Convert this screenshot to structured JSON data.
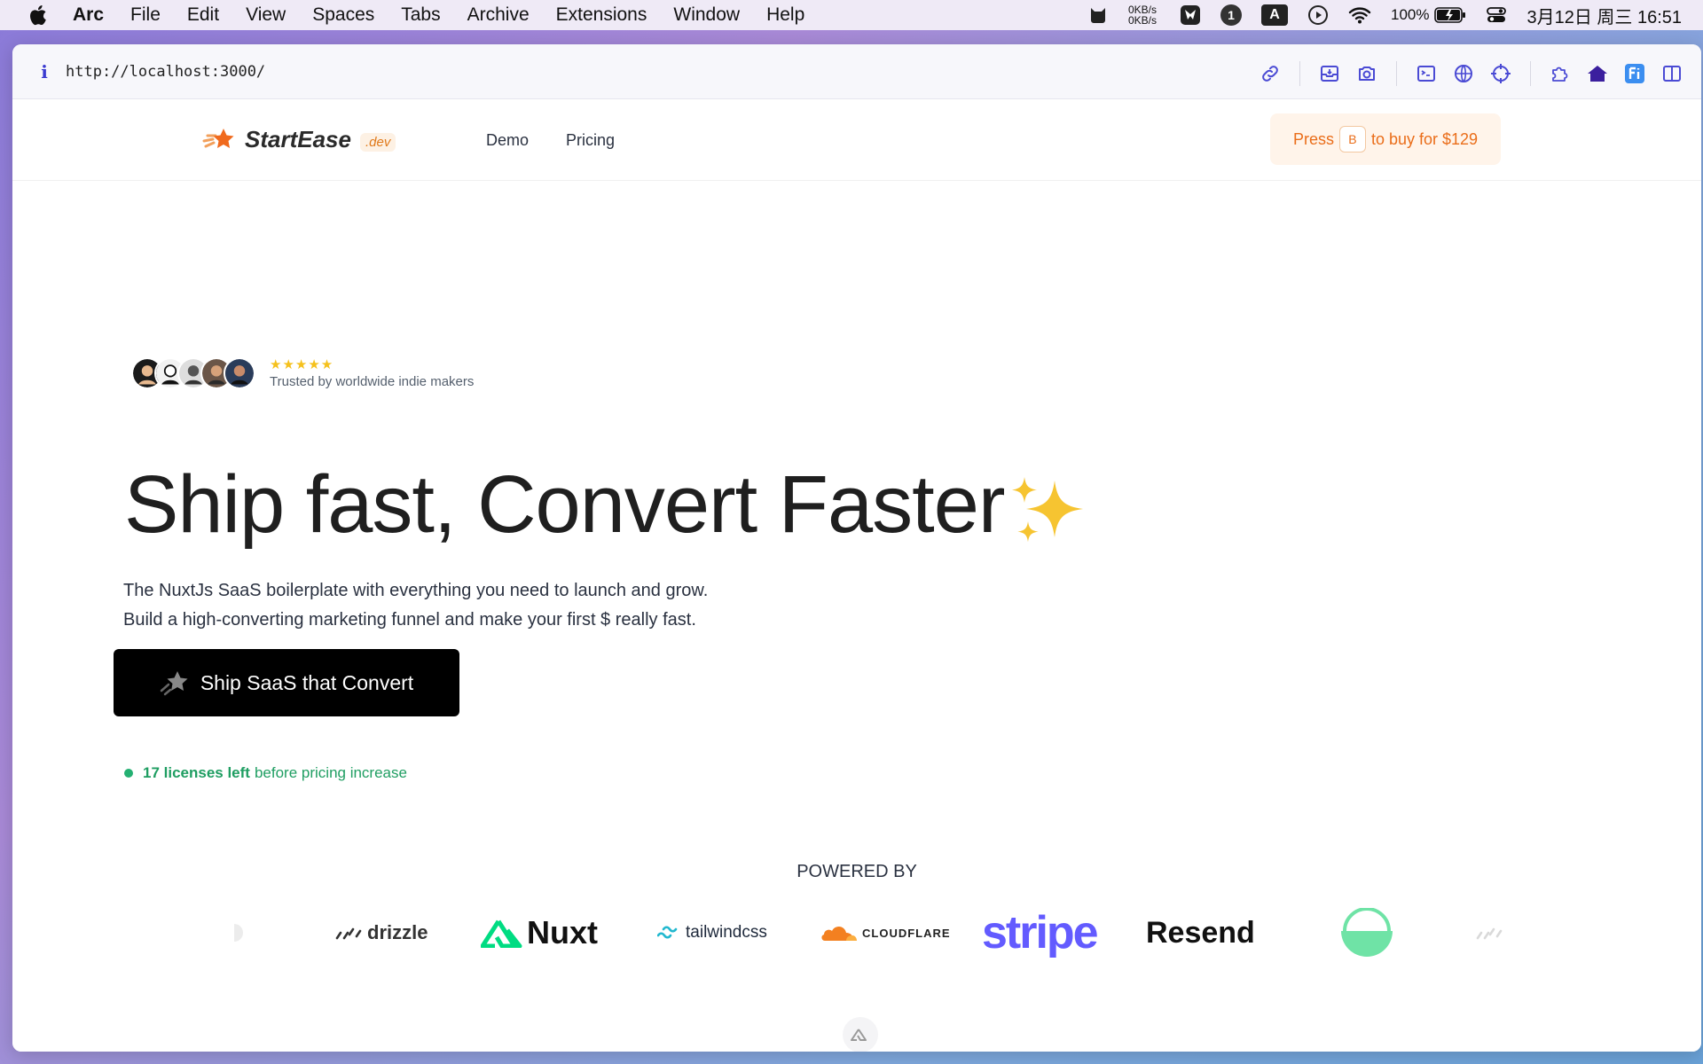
{
  "menubar": {
    "app": "Arc",
    "items": [
      "File",
      "Edit",
      "View",
      "Spaces",
      "Tabs",
      "Archive",
      "Extensions",
      "Window",
      "Help"
    ],
    "net_up": "0KB/s",
    "net_down": "0KB/s",
    "badge_count": "1",
    "input_method": "A",
    "battery": "100%",
    "clock": "3月12日 周三  16:51"
  },
  "browser": {
    "url": "http://localhost:3000/"
  },
  "site": {
    "logo_text": "StartEase",
    "logo_tld": ".dev",
    "nav": [
      "Demo",
      "Pricing"
    ],
    "buy_pre": "Press",
    "buy_key": "B",
    "buy_post": "to buy for $129",
    "stars": "★★★★★",
    "trust_text": "Trusted by worldwide indie makers",
    "headline": "Ship fast, Convert Faster",
    "sub_line1": "The NuxtJs SaaS boilerplate with everything you need to launch and grow.",
    "sub_line2": "Build a high-converting marketing funnel and make your first $ really fast.",
    "cta_label": "Ship SaaS that Convert",
    "licenses_bold": "17 licenses left",
    "licenses_rest": "before pricing increase",
    "powered_by": "POWERED BY",
    "brands": [
      "drizzle",
      "Nuxt",
      "tailwindcss",
      "CLOUDFLARE",
      "stripe",
      "Resend"
    ]
  },
  "colors": {
    "accent_orange": "#ea6d19",
    "license_green": "#1f9e62",
    "stripe_purple": "#635bff"
  }
}
